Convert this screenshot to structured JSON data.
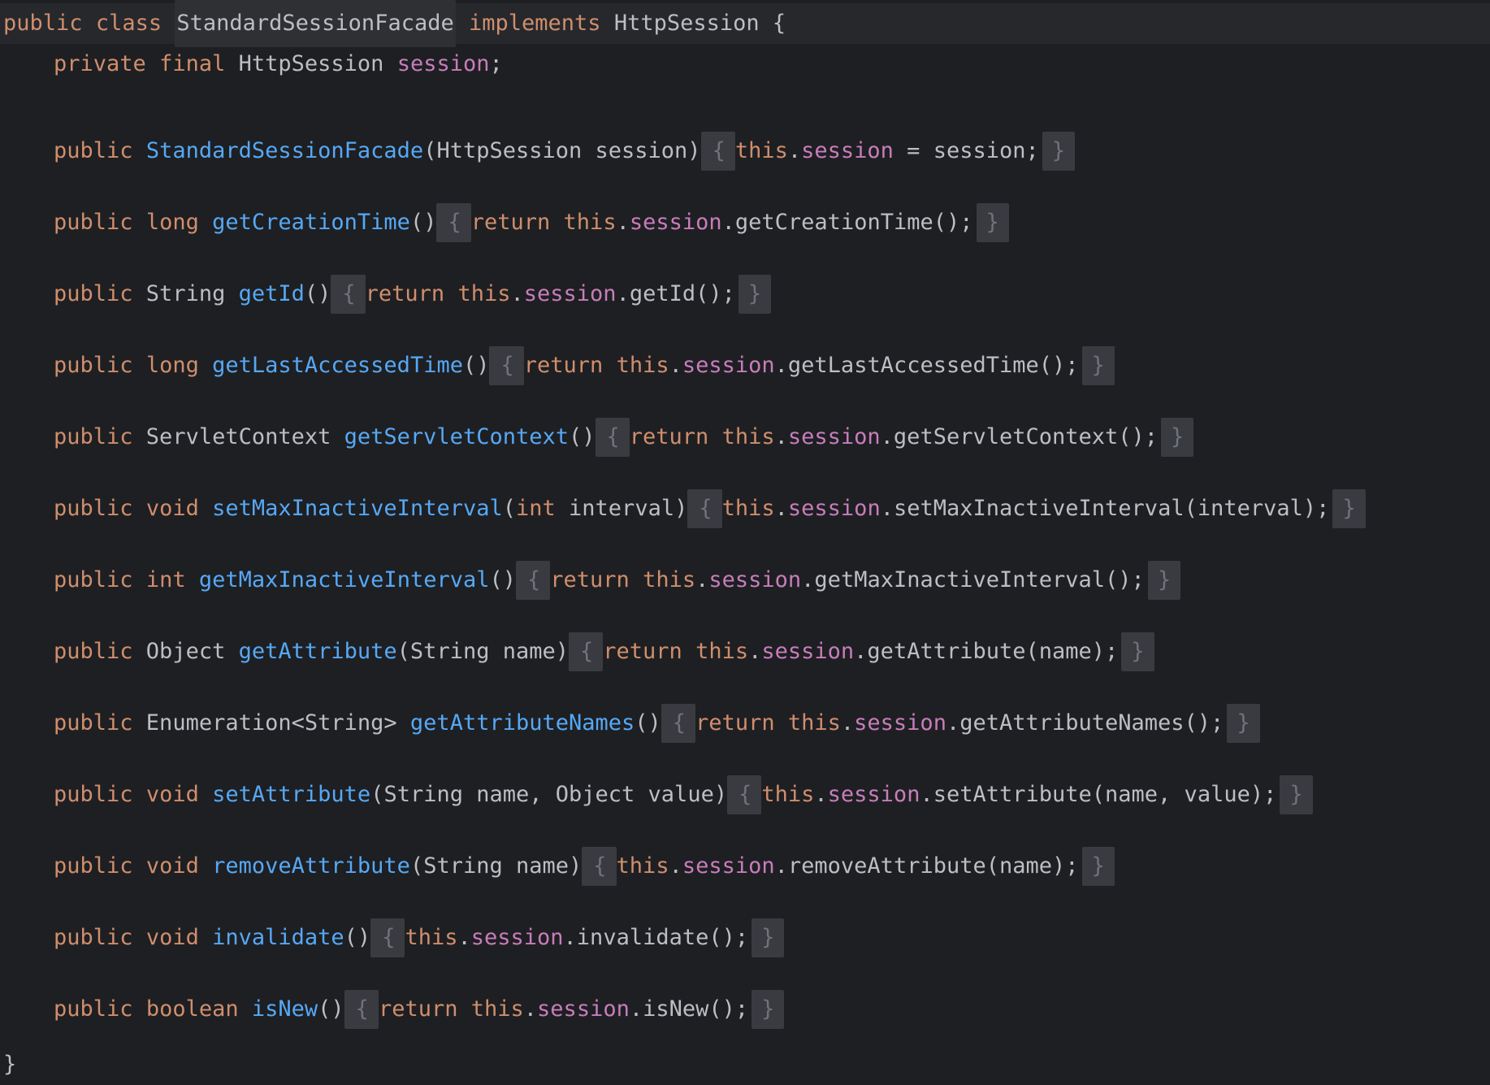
{
  "editor": {
    "header": {
      "kw_public": "public",
      "kw_class": "class",
      "class_name": "StandardSessionFacade",
      "kw_implements": "implements",
      "iface": "HttpSession",
      "open_brace": "{"
    },
    "field": {
      "kw_private": "private",
      "kw_final": "final",
      "type": "HttpSession",
      "name": "session",
      "semi": ";"
    },
    "lines": [
      {
        "id": "ctor",
        "parts": [
          {
            "t": "public",
            "c": "kw"
          },
          {
            "t": " ",
            "c": "plain"
          },
          {
            "t": "StandardSessionFacade",
            "c": "fn"
          },
          {
            "t": "(HttpSession session)",
            "c": "plain"
          }
        ],
        "body": [
          {
            "t": "this",
            "c": "kw"
          },
          {
            "t": ".",
            "c": "plain"
          },
          {
            "t": "session",
            "c": "fld"
          },
          {
            "t": " = session;",
            "c": "plain"
          }
        ]
      },
      {
        "id": "getCreationTime",
        "parts": [
          {
            "t": "public",
            "c": "kw"
          },
          {
            "t": " ",
            "c": "plain"
          },
          {
            "t": "long",
            "c": "kw"
          },
          {
            "t": " ",
            "c": "plain"
          },
          {
            "t": "getCreationTime",
            "c": "fn"
          },
          {
            "t": "()",
            "c": "plain"
          }
        ],
        "body": [
          {
            "t": "return",
            "c": "kw"
          },
          {
            "t": " ",
            "c": "plain"
          },
          {
            "t": "this",
            "c": "kw"
          },
          {
            "t": ".",
            "c": "plain"
          },
          {
            "t": "session",
            "c": "fld"
          },
          {
            "t": ".getCreationTime();",
            "c": "plain"
          }
        ]
      },
      {
        "id": "getId",
        "parts": [
          {
            "t": "public",
            "c": "kw"
          },
          {
            "t": " String ",
            "c": "plain"
          },
          {
            "t": "getId",
            "c": "fn"
          },
          {
            "t": "()",
            "c": "plain"
          }
        ],
        "body": [
          {
            "t": "return",
            "c": "kw"
          },
          {
            "t": " ",
            "c": "plain"
          },
          {
            "t": "this",
            "c": "kw"
          },
          {
            "t": ".",
            "c": "plain"
          },
          {
            "t": "session",
            "c": "fld"
          },
          {
            "t": ".getId();",
            "c": "plain"
          }
        ]
      },
      {
        "id": "getLastAccessedTime",
        "parts": [
          {
            "t": "public",
            "c": "kw"
          },
          {
            "t": " ",
            "c": "plain"
          },
          {
            "t": "long",
            "c": "kw"
          },
          {
            "t": " ",
            "c": "plain"
          },
          {
            "t": "getLastAccessedTime",
            "c": "fn"
          },
          {
            "t": "()",
            "c": "plain"
          }
        ],
        "body": [
          {
            "t": "return",
            "c": "kw"
          },
          {
            "t": " ",
            "c": "plain"
          },
          {
            "t": "this",
            "c": "kw"
          },
          {
            "t": ".",
            "c": "plain"
          },
          {
            "t": "session",
            "c": "fld"
          },
          {
            "t": ".getLastAccessedTime();",
            "c": "plain"
          }
        ]
      },
      {
        "id": "getServletContext",
        "parts": [
          {
            "t": "public",
            "c": "kw"
          },
          {
            "t": " ServletContext ",
            "c": "plain"
          },
          {
            "t": "getServletContext",
            "c": "fn"
          },
          {
            "t": "()",
            "c": "plain"
          }
        ],
        "body": [
          {
            "t": "return",
            "c": "kw"
          },
          {
            "t": " ",
            "c": "plain"
          },
          {
            "t": "this",
            "c": "kw"
          },
          {
            "t": ".",
            "c": "plain"
          },
          {
            "t": "session",
            "c": "fld"
          },
          {
            "t": ".getServletContext();",
            "c": "plain"
          }
        ]
      },
      {
        "id": "setMaxInactiveInterval",
        "parts": [
          {
            "t": "public",
            "c": "kw"
          },
          {
            "t": " ",
            "c": "plain"
          },
          {
            "t": "void",
            "c": "kw"
          },
          {
            "t": " ",
            "c": "plain"
          },
          {
            "t": "setMaxInactiveInterval",
            "c": "fn"
          },
          {
            "t": "(",
            "c": "plain"
          },
          {
            "t": "int",
            "c": "kw"
          },
          {
            "t": " interval)",
            "c": "plain"
          }
        ],
        "body": [
          {
            "t": "this",
            "c": "kw"
          },
          {
            "t": ".",
            "c": "plain"
          },
          {
            "t": "session",
            "c": "fld"
          },
          {
            "t": ".setMaxInactiveInterval(interval);",
            "c": "plain"
          }
        ]
      },
      {
        "id": "getMaxInactiveInterval",
        "parts": [
          {
            "t": "public",
            "c": "kw"
          },
          {
            "t": " ",
            "c": "plain"
          },
          {
            "t": "int",
            "c": "kw"
          },
          {
            "t": " ",
            "c": "plain"
          },
          {
            "t": "getMaxInactiveInterval",
            "c": "fn"
          },
          {
            "t": "()",
            "c": "plain"
          }
        ],
        "body": [
          {
            "t": "return",
            "c": "kw"
          },
          {
            "t": " ",
            "c": "plain"
          },
          {
            "t": "this",
            "c": "kw"
          },
          {
            "t": ".",
            "c": "plain"
          },
          {
            "t": "session",
            "c": "fld"
          },
          {
            "t": ".getMaxInactiveInterval();",
            "c": "plain"
          }
        ]
      },
      {
        "id": "getAttribute",
        "parts": [
          {
            "t": "public",
            "c": "kw"
          },
          {
            "t": " Object ",
            "c": "plain"
          },
          {
            "t": "getAttribute",
            "c": "fn"
          },
          {
            "t": "(String name)",
            "c": "plain"
          }
        ],
        "body": [
          {
            "t": "return",
            "c": "kw"
          },
          {
            "t": " ",
            "c": "plain"
          },
          {
            "t": "this",
            "c": "kw"
          },
          {
            "t": ".",
            "c": "plain"
          },
          {
            "t": "session",
            "c": "fld"
          },
          {
            "t": ".getAttribute(name);",
            "c": "plain"
          }
        ]
      },
      {
        "id": "getAttributeNames",
        "parts": [
          {
            "t": "public",
            "c": "kw"
          },
          {
            "t": " Enumeration<String> ",
            "c": "plain"
          },
          {
            "t": "getAttributeNames",
            "c": "fn"
          },
          {
            "t": "()",
            "c": "plain"
          }
        ],
        "body": [
          {
            "t": "return",
            "c": "kw"
          },
          {
            "t": " ",
            "c": "plain"
          },
          {
            "t": "this",
            "c": "kw"
          },
          {
            "t": ".",
            "c": "plain"
          },
          {
            "t": "session",
            "c": "fld"
          },
          {
            "t": ".getAttributeNames();",
            "c": "plain"
          }
        ]
      },
      {
        "id": "setAttribute",
        "parts": [
          {
            "t": "public",
            "c": "kw"
          },
          {
            "t": " ",
            "c": "plain"
          },
          {
            "t": "void",
            "c": "kw"
          },
          {
            "t": " ",
            "c": "plain"
          },
          {
            "t": "setAttribute",
            "c": "fn"
          },
          {
            "t": "(String name, Object value)",
            "c": "plain"
          }
        ],
        "body": [
          {
            "t": "this",
            "c": "kw"
          },
          {
            "t": ".",
            "c": "plain"
          },
          {
            "t": "session",
            "c": "fld"
          },
          {
            "t": ".setAttribute(name, value);",
            "c": "plain"
          }
        ]
      },
      {
        "id": "removeAttribute",
        "parts": [
          {
            "t": "public",
            "c": "kw"
          },
          {
            "t": " ",
            "c": "plain"
          },
          {
            "t": "void",
            "c": "kw"
          },
          {
            "t": " ",
            "c": "plain"
          },
          {
            "t": "removeAttribute",
            "c": "fn"
          },
          {
            "t": "(String name)",
            "c": "plain"
          }
        ],
        "body": [
          {
            "t": "this",
            "c": "kw"
          },
          {
            "t": ".",
            "c": "plain"
          },
          {
            "t": "session",
            "c": "fld"
          },
          {
            "t": ".removeAttribute(name);",
            "c": "plain"
          }
        ]
      },
      {
        "id": "invalidate",
        "parts": [
          {
            "t": "public",
            "c": "kw"
          },
          {
            "t": " ",
            "c": "plain"
          },
          {
            "t": "void",
            "c": "kw"
          },
          {
            "t": " ",
            "c": "plain"
          },
          {
            "t": "invalidate",
            "c": "fn"
          },
          {
            "t": "()",
            "c": "plain"
          }
        ],
        "body": [
          {
            "t": "this",
            "c": "kw"
          },
          {
            "t": ".",
            "c": "plain"
          },
          {
            "t": "session",
            "c": "fld"
          },
          {
            "t": ".invalidate();",
            "c": "plain"
          }
        ]
      },
      {
        "id": "isNew",
        "parts": [
          {
            "t": "public",
            "c": "kw"
          },
          {
            "t": " ",
            "c": "plain"
          },
          {
            "t": "boolean",
            "c": "kw"
          },
          {
            "t": " ",
            "c": "plain"
          },
          {
            "t": "isNew",
            "c": "fn"
          },
          {
            "t": "()",
            "c": "plain"
          }
        ],
        "body": [
          {
            "t": "return",
            "c": "kw"
          },
          {
            "t": " ",
            "c": "plain"
          },
          {
            "t": "this",
            "c": "kw"
          },
          {
            "t": ".",
            "c": "plain"
          },
          {
            "t": "session",
            "c": "fld"
          },
          {
            "t": ".isNew();",
            "c": "plain"
          }
        ]
      }
    ],
    "fold_open": "{",
    "fold_close": "}",
    "closing_brace": "}",
    "colors": {
      "background": "#1e1f22",
      "keyword": "#cf8e6d",
      "function": "#56a8f5",
      "field": "#c77dbb",
      "text": "#bcbec4",
      "fold_bg": "#393b40"
    }
  }
}
